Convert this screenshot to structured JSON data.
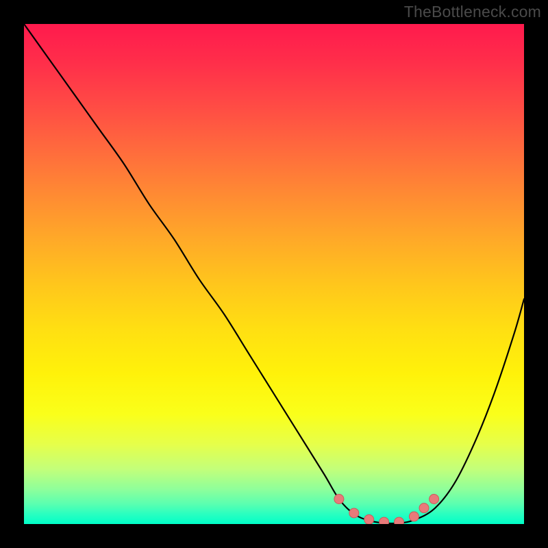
{
  "watermark": "TheBottleneck.com",
  "colors": {
    "frame": "#000000",
    "curve": "#000000",
    "marker_fill": "#e87a7a",
    "marker_stroke": "#c95b5b"
  },
  "chart_data": {
    "type": "line",
    "title": "",
    "xlabel": "",
    "ylabel": "",
    "xlim": [
      0,
      100
    ],
    "ylim": [
      0,
      100
    ],
    "grid": false,
    "legend": false,
    "series": [
      {
        "name": "bottleneck-curve",
        "x": [
          0,
          5,
          10,
          15,
          20,
          25,
          30,
          35,
          40,
          45,
          50,
          55,
          60,
          63,
          66,
          69,
          72,
          75,
          78,
          82,
          86,
          90,
          94,
          98,
          100
        ],
        "y": [
          100,
          93,
          86,
          79,
          72,
          64,
          57,
          49,
          42,
          34,
          26,
          18,
          10,
          5,
          2,
          0.7,
          0.2,
          0.2,
          0.8,
          3,
          8,
          16,
          26,
          38,
          45
        ]
      }
    ],
    "markers": {
      "name": "optimal-range",
      "points": [
        {
          "x": 63,
          "y": 5
        },
        {
          "x": 66,
          "y": 2.2
        },
        {
          "x": 69,
          "y": 0.9
        },
        {
          "x": 72,
          "y": 0.4
        },
        {
          "x": 75,
          "y": 0.4
        },
        {
          "x": 78,
          "y": 1.5
        },
        {
          "x": 80,
          "y": 3.2
        },
        {
          "x": 82,
          "y": 5
        }
      ]
    }
  }
}
